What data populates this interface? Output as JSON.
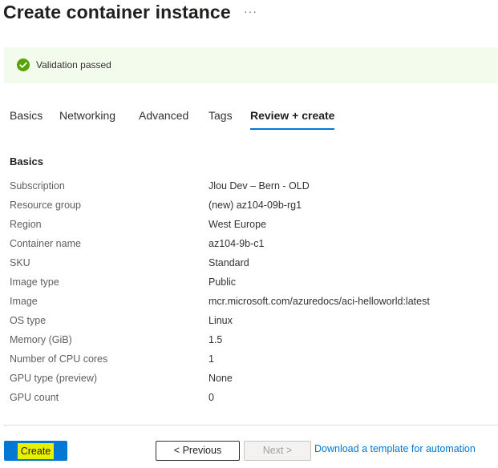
{
  "header": {
    "title": "Create container instance",
    "more_label": "···"
  },
  "validation": {
    "icon": "check-circle-icon",
    "message": "Validation passed",
    "color": "#57a300"
  },
  "tabs": [
    {
      "label": "Basics",
      "active": false
    },
    {
      "label": "Networking",
      "active": false
    },
    {
      "label": "Advanced",
      "active": false
    },
    {
      "label": "Tags",
      "active": false
    },
    {
      "label": "Review + create",
      "active": true
    }
  ],
  "section": {
    "title": "Basics"
  },
  "summary": [
    {
      "key": "Subscription",
      "value": "Jlou Dev – Bern - OLD"
    },
    {
      "key": "Resource group",
      "value": "(new) az104-09b-rg1"
    },
    {
      "key": "Region",
      "value": "West Europe"
    },
    {
      "key": "Container name",
      "value": "az104-9b-c1"
    },
    {
      "key": "SKU",
      "value": "Standard"
    },
    {
      "key": "Image type",
      "value": "Public"
    },
    {
      "key": "Image",
      "value": "mcr.microsoft.com/azuredocs/aci-helloworld:latest"
    },
    {
      "key": "OS type",
      "value": "Linux"
    },
    {
      "key": "Memory (GiB)",
      "value": "1.5"
    },
    {
      "key": "Number of CPU cores",
      "value": "1"
    },
    {
      "key": "GPU type (preview)",
      "value": "None"
    },
    {
      "key": "GPU count",
      "value": "0"
    }
  ],
  "footer": {
    "create_label": "Create",
    "previous_label": "< Previous",
    "next_label": "Next >",
    "download_link": "Download a template for automation"
  },
  "colors": {
    "accent": "#0078d4",
    "success": "#57a300",
    "highlight": "#e8f000"
  }
}
